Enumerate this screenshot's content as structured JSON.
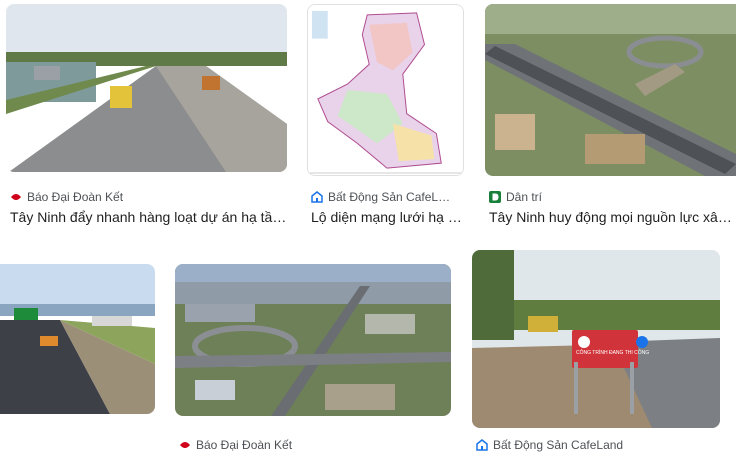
{
  "results": [
    {
      "source": "Báo Đại Đoàn Kết",
      "source_icon": "dai-doan-ket-logo-icon",
      "title": "Tây Ninh đẩy nhanh hàng loạt dự án hạ tầng giao thông"
    },
    {
      "source": "Bất Động Sản CafeLand",
      "source_icon": "cafeland-logo-icon",
      "title": "Lộ diện mạng lưới hạ tầng giao thông Tây Ninh"
    },
    {
      "source": "Dân trí",
      "source_icon": "dan-tri-logo-icon",
      "title": "Tây Ninh huy động mọi nguồn lực xây dựng hạ tầng"
    },
    {
      "source": "",
      "source_icon": "",
      "title": ""
    },
    {
      "source": "Báo Đại Đoàn Kết",
      "source_icon": "dai-doan-ket-logo-icon",
      "title": ""
    },
    {
      "source": "Bất Động Sản CafeLand",
      "source_icon": "cafeland-logo-icon",
      "title": ""
    }
  ],
  "sign_text": "CÔNG TRÌNH ĐANG THI CÔNG",
  "colors": {
    "text": "#1f1f1f",
    "meta": "#4d5156",
    "dai_doan_ket": "#d0021b",
    "cafeland": "#1a73e8",
    "dan_tri": "#188038"
  }
}
